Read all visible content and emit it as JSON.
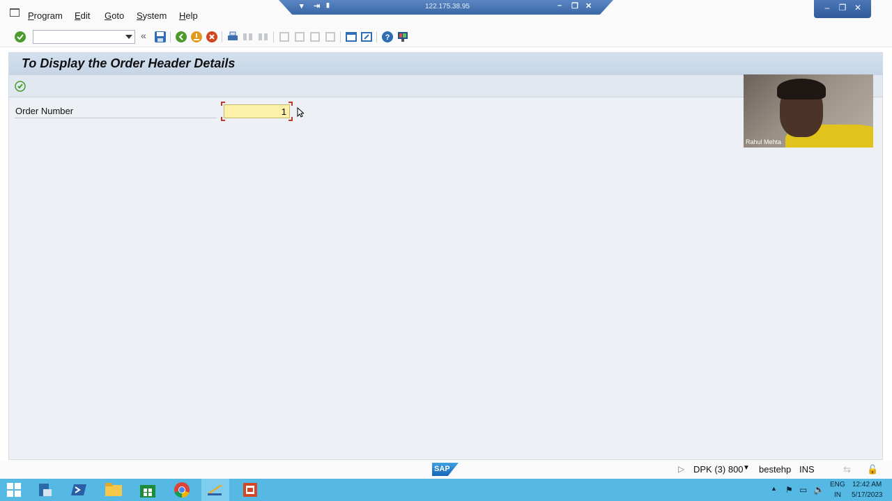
{
  "remote_session": {
    "host": "122.175.38.95"
  },
  "menu": {
    "items": [
      "Program",
      "Edit",
      "Goto",
      "System",
      "Help"
    ]
  },
  "toolbar": {
    "command_field_value": ""
  },
  "screen": {
    "title": "To Display the Order Header Details",
    "fields": [
      {
        "label": "Order Number",
        "value": "1"
      }
    ]
  },
  "webcam": {
    "participant_name": "Rahul Mehta"
  },
  "status_bar": {
    "logo": "SAP",
    "system": "DPK (3) 800",
    "server": "bestehp",
    "mode": "INS"
  },
  "taskbar": {
    "language": "ENG",
    "region": "IN",
    "time": "12:42 AM",
    "date": "5/17/2023"
  },
  "colors": {
    "screen_bg": "#edf1f6",
    "title_bg": "#c5d5e6",
    "input_bg": "#fdf0a8",
    "taskbar_bg": "#55b9e3"
  }
}
